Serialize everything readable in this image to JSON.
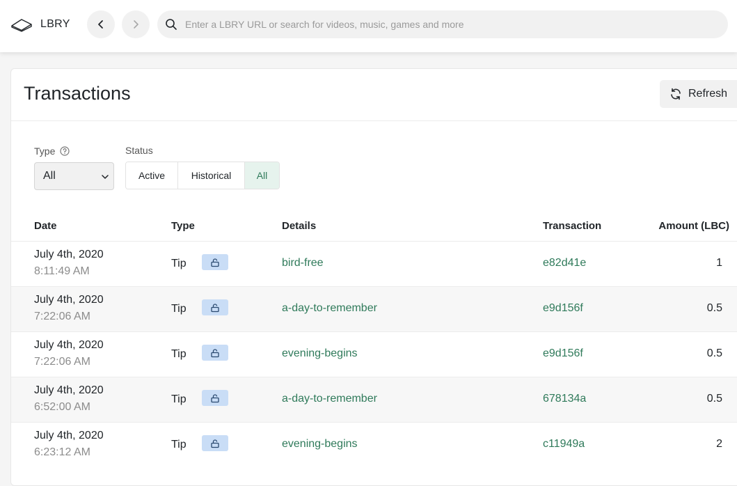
{
  "header": {
    "logo_text": "LBRY",
    "search_placeholder": "Enter a LBRY URL or search for videos, music, games and more"
  },
  "card": {
    "title": "Transactions",
    "refresh_label": "Refresh"
  },
  "filters": {
    "type_label": "Type",
    "type_value": "All",
    "status_label": "Status",
    "status_options": [
      "Active",
      "Historical",
      "All"
    ],
    "status_selected": "All"
  },
  "table": {
    "headers": {
      "date": "Date",
      "type": "Type",
      "details": "Details",
      "transaction": "Transaction",
      "amount": "Amount (LBC)"
    },
    "rows": [
      {
        "date": "July 4th, 2020",
        "time": "8:11:49 AM",
        "type": "Tip",
        "details": "bird-free",
        "txid": "e82d41e",
        "amount": "1"
      },
      {
        "date": "July 4th, 2020",
        "time": "7:22:06 AM",
        "type": "Tip",
        "details": "a-day-to-remember",
        "txid": "e9d156f",
        "amount": "0.5"
      },
      {
        "date": "July 4th, 2020",
        "time": "7:22:06 AM",
        "type": "Tip",
        "details": "evening-begins",
        "txid": "e9d156f",
        "amount": "0.5"
      },
      {
        "date": "July 4th, 2020",
        "time": "6:52:00 AM",
        "type": "Tip",
        "details": "a-day-to-remember",
        "txid": "678134a",
        "amount": "0.5"
      },
      {
        "date": "July 4th, 2020",
        "time": "6:23:12 AM",
        "type": "Tip",
        "details": "evening-begins",
        "txid": "c11949a",
        "amount": "2"
      }
    ]
  },
  "colors": {
    "accent_green": "#2f7a5a",
    "selected_bg": "#e6f3ed",
    "lock_badge_bg": "#c9ddf6"
  },
  "icons": {
    "logo": "lbry-logo-icon",
    "back": "chevron-left-icon",
    "forward": "chevron-right-icon",
    "search": "search-icon",
    "refresh": "refresh-icon",
    "help": "help-circle-icon",
    "select": "chevron-down-icon",
    "lock": "unlock-icon"
  }
}
